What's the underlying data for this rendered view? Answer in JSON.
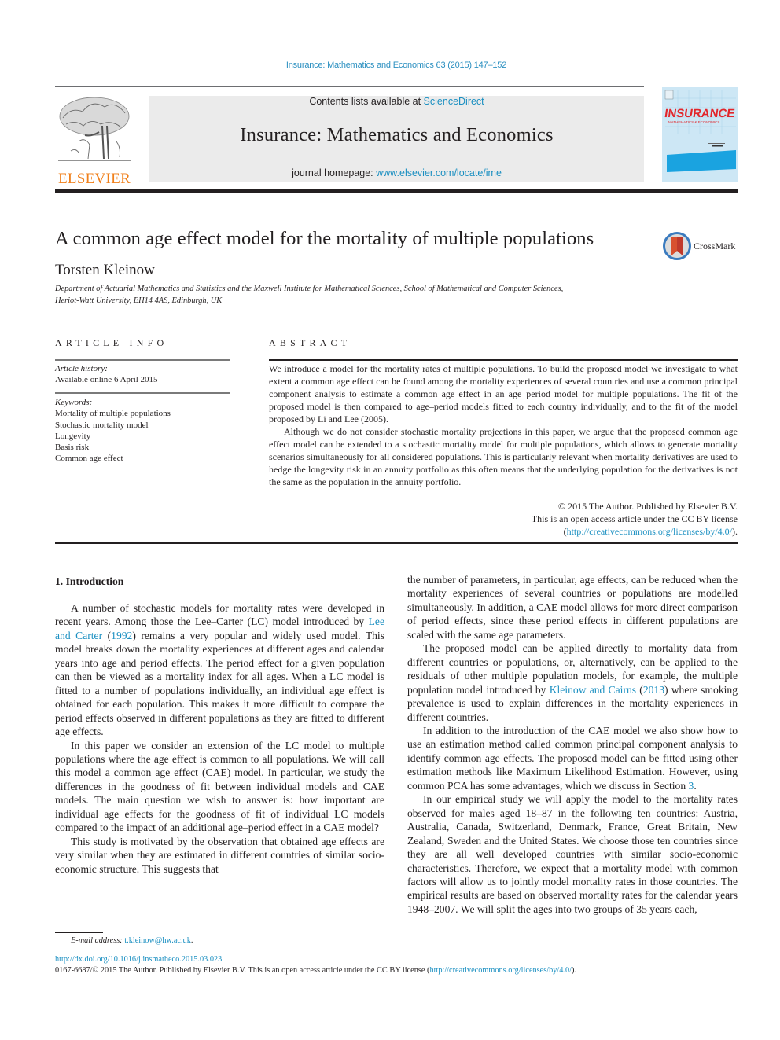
{
  "running_header": {
    "journal_ref": "Insurance: Mathematics and Economics 63 (2015) 147–152"
  },
  "banner": {
    "publisher_logo_text": "ELSEVIER",
    "contents_prefix": "Contents lists available at ",
    "contents_link": "ScienceDirect",
    "journal_title": "Insurance: Mathematics and Economics",
    "homepage_prefix": "journal homepage: ",
    "homepage_link": "www.elsevier.com/locate/ime",
    "cover_title": "INSURANCE",
    "cover_subtitle": "MATHEMATICS & ECONOMICS"
  },
  "article": {
    "title": "A common age effect model for the mortality of multiple populations",
    "crossmark_label": "CrossMark",
    "author": "Torsten Kleinow",
    "affiliation_line1": "Department of Actuarial Mathematics and Statistics and the Maxwell Institute for Mathematical Sciences, School of Mathematical and Computer Sciences,",
    "affiliation_line2": "Heriot-Watt University, EH14 4AS, Edinburgh, UK"
  },
  "article_info": {
    "heading": "ARTICLE INFO",
    "history_label": "Article history:",
    "history_value": "Available online 6 April 2015",
    "keywords_label": "Keywords:",
    "keywords": [
      "Mortality of multiple populations",
      "Stochastic mortality model",
      "Longevity",
      "Basis risk",
      "Common age effect"
    ]
  },
  "abstract": {
    "heading": "ABSTRACT",
    "p1": "We introduce a model for the mortality rates of multiple populations. To build the proposed model we investigate to what extent a common age effect can be found among the mortality experiences of several countries and use a common principal component analysis to estimate a common age effect in an age–period model for multiple populations. The fit of the proposed model is then compared to age–period models fitted to each country individually, and to the fit of the model proposed by Li and Lee (2005).",
    "p2": "Although we do not consider stochastic mortality projections in this paper, we argue that the proposed common age effect model can be extended to a stochastic mortality model for multiple populations, which allows to generate mortality scenarios simultaneously for all considered populations. This is particularly relevant when mortality derivatives are used to hedge the longevity risk in an annuity portfolio as this often means that the underlying population for the derivatives is not the same as the population in the annuity portfolio.",
    "copyright": "© 2015 The Author. Published by Elsevier B.V.",
    "license_text": "This is an open access article under the CC BY license",
    "license_open": "(",
    "license_link": "http://creativecommons.org/licenses/by/4.0/",
    "license_close": ")."
  },
  "body": {
    "section_heading": "1.  Introduction",
    "left": {
      "p1_a": "A number of stochastic models for mortality rates were developed in recent years. Among those the Lee–Carter (LC) model introduced by ",
      "p1_link1": "Lee and Carter",
      "p1_b": " (",
      "p1_link2": "1992",
      "p1_c": ") remains a very popular and widely used model. This model breaks down the mortality experiences at different ages and calendar years into age and period effects. The period effect for a given population can then be viewed as a mortality index for all ages. When a LC model is fitted to a number of populations individually, an individual age effect is obtained for each population. This makes it more difficult to compare the period effects observed in different populations as they are fitted to different age effects.",
      "p2": "In this paper we consider an extension of the LC model to multiple populations where the age effect is common to all populations. We will call this model a common age effect (CAE) model. In particular, we study the differences in the goodness of fit between individual models and CAE models. The main question we wish to answer is: how important are individual age effects for the goodness of fit of individual LC models compared to the impact of an additional age–period effect in a CAE model?",
      "p3": "This study is motivated by the observation that obtained age effects are very similar when they are estimated in different countries of similar socio-economic structure. This suggests that"
    },
    "right": {
      "p0": "the number of parameters, in particular, age effects, can be reduced when the mortality experiences of several countries or populations are modelled simultaneously. In addition, a CAE model allows for more direct comparison of period effects, since these period effects in different populations are scaled with the same age parameters.",
      "p1_a": "The proposed model can be applied directly to mortality data from different countries or populations, or, alternatively, can be applied to the residuals of other multiple population models, for example, the multiple population model introduced by ",
      "p1_link1": "Kleinow and Cairns",
      "p1_b": " (",
      "p1_link2": "2013",
      "p1_c": ") where smoking prevalence is used to explain differences in the mortality experiences in different countries.",
      "p2_a": "In addition to the introduction of the CAE model we also show how to use an estimation method called common principal component analysis to identify common age effects. The proposed model can be fitted using other estimation methods like Maximum Likelihood Estimation. However, using common PCA has some advantages, which we discuss in Section ",
      "p2_link": "3",
      "p2_b": ".",
      "p3": "In our empirical study we will apply the model to the mortality rates observed for males aged 18–87 in the following ten countries: Austria, Australia, Canada, Switzerland, Denmark, France, Great Britain, New Zealand, Sweden and the United States. We choose those ten countries since they are all well developed countries with similar socio-economic characteristics. Therefore, we expect that a mortality model with common factors will allow us to jointly model mortality rates in those countries. The empirical results are based on observed mortality rates for the calendar years 1948–2007. We will split the ages into two groups of 35 years each,"
    }
  },
  "footer": {
    "email_label": "E-mail address: ",
    "email": "t.kleinow@hw.ac.uk",
    "email_end": ".",
    "doi": "http://dx.doi.org/10.1016/j.insmatheco.2015.03.023",
    "license_prefix": "0167-6687/© 2015 The Author. Published by Elsevier B.V. This is an open access article under the CC BY license (",
    "license_link": "http://creativecommons.org/licenses/by/4.0/",
    "license_suffix": ")."
  }
}
